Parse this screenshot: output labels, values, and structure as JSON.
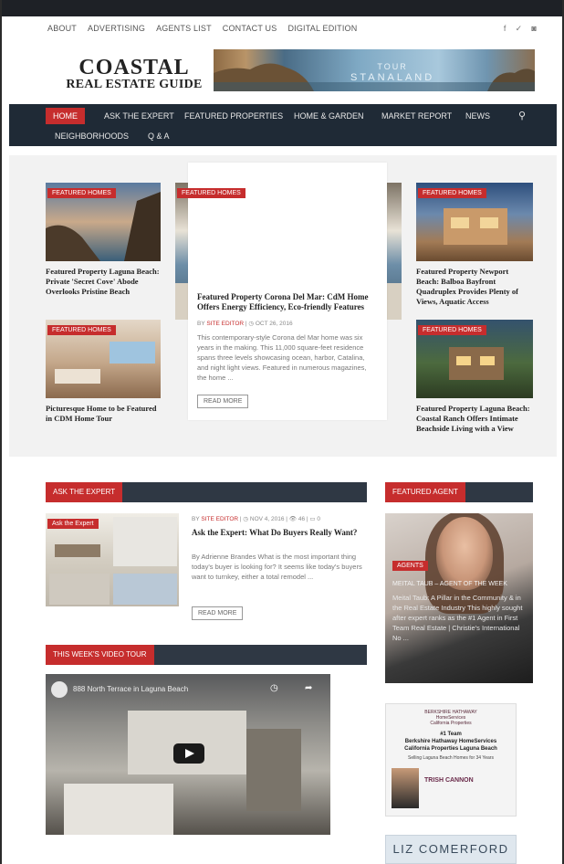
{
  "utility_nav": [
    "ABOUT",
    "ADVERTISING",
    "AGENTS LIST",
    "CONTACT US",
    "DIGITAL EDITION"
  ],
  "social_icons": [
    "facebook-icon",
    "twitter-icon",
    "instagram-icon"
  ],
  "logo": {
    "line1": "COASTAL",
    "line2": "REAL ESTATE GUIDE"
  },
  "banner": {
    "line1": "TOUR",
    "line2": "STANALAND"
  },
  "main_nav": {
    "row1": [
      "HOME",
      "ASK THE EXPERT",
      "FEATURED PROPERTIES",
      "HOME & GARDEN",
      "MARKET REPORT",
      "NEWS"
    ],
    "row2": [
      "NEIGHBORHOODS",
      "Q & A"
    ],
    "search_icon": "search-icon"
  },
  "featured": {
    "tag": "FEATURED HOMES",
    "cards": [
      {
        "title": "Featured Property Laguna Beach: Private 'Secret Cove' Abode Overlooks Pristine Beach"
      },
      {
        "title": "Picturesque Home to be Featured in CDM Home Tour"
      },
      {
        "title": "Featured Property Newport Beach: Balboa Bayfront Quadruplex Provides Plenty of Views, Aquatic Access"
      },
      {
        "title": "Featured Property Laguna Beach: Coastal Ranch Offers Intimate Beachside Living with a View"
      }
    ],
    "main": {
      "title": "Featured Property Corona Del Mar: CdM Home Offers Energy Efficiency, Eco-friendly Features",
      "by": "BY",
      "author": "SITE EDITOR",
      "date": "OCT 26, 2016",
      "excerpt": "This contemporary-style Corona del Mar home was six years in the making. This 11,000 square-feet residence spans three levels showcasing ocean, harbor, Catalina, and night light views. Featured in numerous magazines, the home ...",
      "read_more": "READ MORE"
    }
  },
  "ask_expert": {
    "section": "ASK THE EXPERT",
    "thumb_tag": "Ask the Expert",
    "by": "BY",
    "author": "SITE EDITOR",
    "date": "NOV 4, 2016",
    "views": "46",
    "comments": "0",
    "title": "Ask the Expert: What Do Buyers Really Want?",
    "excerpt": "By Adrienne Brandes What is the most important thing today's buyer is looking for? It seems like today's buyers want to turnkey, either a total remodel ...",
    "read_more": "READ MORE"
  },
  "featured_agent": {
    "section": "FEATURED AGENT",
    "tag": "AGENTS",
    "name": "MEITAL TAUB – AGENT OF THE WEEK",
    "text": "Meital Taub: A Pillar in the Community & in the Real Estate Industry This highly sought after expert ranks as the #1 Agent in First Team Real Estate | Christie's International No ..."
  },
  "video_tour": {
    "section": "THIS WEEK'S VIDEO TOUR",
    "video_title": "888 North Terrace in Laguna Beach"
  },
  "ads": {
    "ad1_lines": [
      "BERKSHIRE HATHAWAY",
      "HomeServices",
      "California Properties",
      "#1 Team",
      "Berkshire Hathaway HomeServices",
      "California Properties Laguna Beach",
      "Selling Laguna Beach Homes for 34 Years",
      "TRISH CANNON"
    ],
    "ad2": "LIZ COMERFORD"
  },
  "colors": {
    "accent": "#c62d2d",
    "nav": "#1f2a36",
    "section_bar": "#2f3844"
  }
}
